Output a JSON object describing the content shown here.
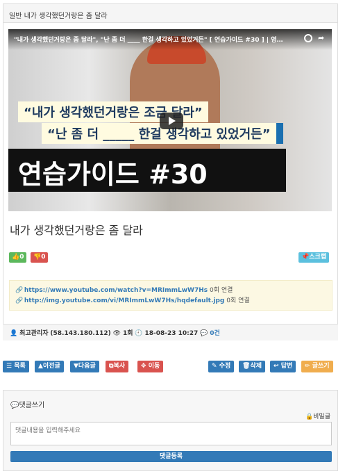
{
  "header": {
    "category_title": "일반 내가 생각했던거랑은 좀 달라"
  },
  "video": {
    "title": "\"내가 생각했던거랑은 좀 달라\", \"난 좀 더 ____ 한걸 생각하고 있었거든\" [ 연습가이드 #30 ] | 영…",
    "caption_1": "“내가 생각했던거랑은 조금 달라”",
    "caption_2": "“난 좀 더 _____ 한걸 생각하고 있었거든”",
    "caption_3": "연습가이드 #30"
  },
  "post": {
    "title": "내가 생각했던거랑은 좀 달라"
  },
  "votes": {
    "good_count": "0",
    "nogood_count": "0",
    "scrap_label": "스크랩"
  },
  "links": [
    {
      "url": "https://www.youtube.com/watch?v=MRImmLwW7Hs",
      "count": "0회 연결"
    },
    {
      "url": "http://img.youtube.com/vi/MRImmLwW7Hs/hqdefault.jpg",
      "count": "0회 연결"
    }
  ],
  "meta": {
    "author": "최고관리자",
    "ip": "(58.143.180.112)",
    "views": "1회",
    "datetime": "18-08-23 10:27",
    "comments": "0건"
  },
  "toolbar": {
    "list": "목록",
    "prev": "이전글",
    "next": "다음글",
    "copy": "복사",
    "move": "이동",
    "edit": "수정",
    "delete": "삭제",
    "reply": "답변",
    "write": "글쓰기"
  },
  "comment": {
    "heading": "댓글쓰기",
    "secret_label": "비밀글",
    "placeholder": "댓글내용을 입력해주세요",
    "submit_label": "댓글등록"
  }
}
